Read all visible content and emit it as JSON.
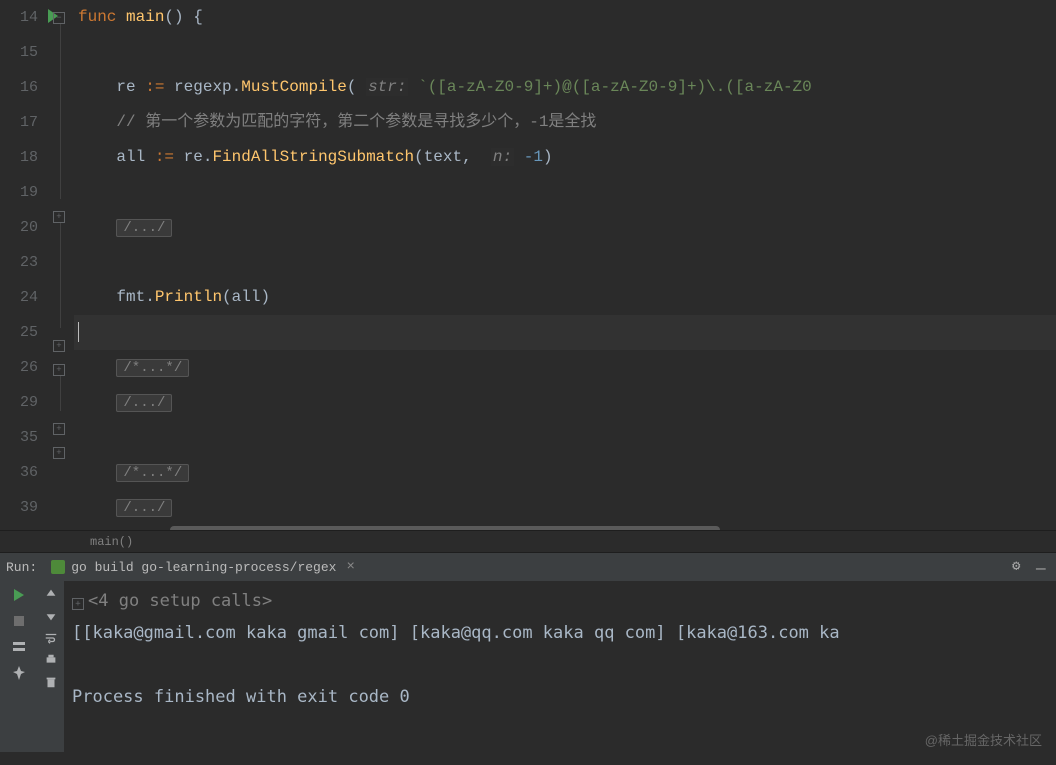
{
  "gutter_lines": [
    "14",
    "15",
    "16",
    "17",
    "18",
    "19",
    "20",
    "23",
    "24",
    "25",
    "26",
    "29",
    "35",
    "36",
    "39"
  ],
  "code": {
    "l14": {
      "kw": "func",
      "name": "main"
    },
    "l16": {
      "v": "re",
      "op": ":=",
      "pkg": "regexp",
      "fn": "MustCompile",
      "plabel": "str:",
      "strv": "`([a-zA-Z0-9]+)@([a-zA-Z0-9]+)\\.([a-zA-Z0"
    },
    "l17": "//  第一个参数为匹配的字符，第二个参数是寻找多少个，-1是全找",
    "l18": {
      "v": "all",
      "op": ":=",
      "obj": "re",
      "fn": "FindAllStringSubmatch",
      "a1": "text",
      "plabel": "n:",
      "num": "-1"
    },
    "l20": "/.../",
    "l24": {
      "pkg": "fmt",
      "fn": "Println",
      "arg": "all"
    },
    "l26": "/*...*/",
    "l29": "/.../",
    "l36": "/*...*/",
    "l39": "/.../"
  },
  "breadcrumb": "main()",
  "run": {
    "label": "Run:",
    "tab": "go build go-learning-process/regex",
    "setup": "<4 go setup calls>",
    "out1": "[[kaka@gmail.com kaka gmail com] [kaka@qq.com kaka qq com] [kaka@163.com ka",
    "exit": "Process finished with exit code 0"
  },
  "watermark": "@稀土掘金技术社区"
}
